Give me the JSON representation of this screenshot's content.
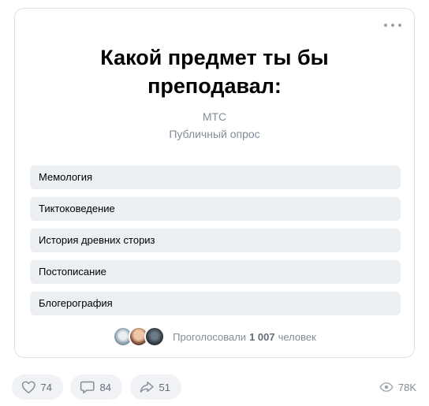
{
  "poll": {
    "title": "Какой предмет ты бы преподавал:",
    "author": "МТС",
    "type": "Публичный опрос",
    "options": [
      "Мемология",
      "Тиктоковедение",
      "История древних сториз",
      "Постописание",
      "Блогерография"
    ],
    "voters": {
      "prefix": "Проголосовали",
      "count": "1 007",
      "suffix": "человек"
    }
  },
  "footer": {
    "likes": "74",
    "comments": "84",
    "shares": "51",
    "views": "78K"
  },
  "icons": {
    "more": "more-horizontal-icon",
    "like": "heart-icon",
    "comment": "comment-icon",
    "share": "share-icon",
    "views": "eye-icon"
  }
}
